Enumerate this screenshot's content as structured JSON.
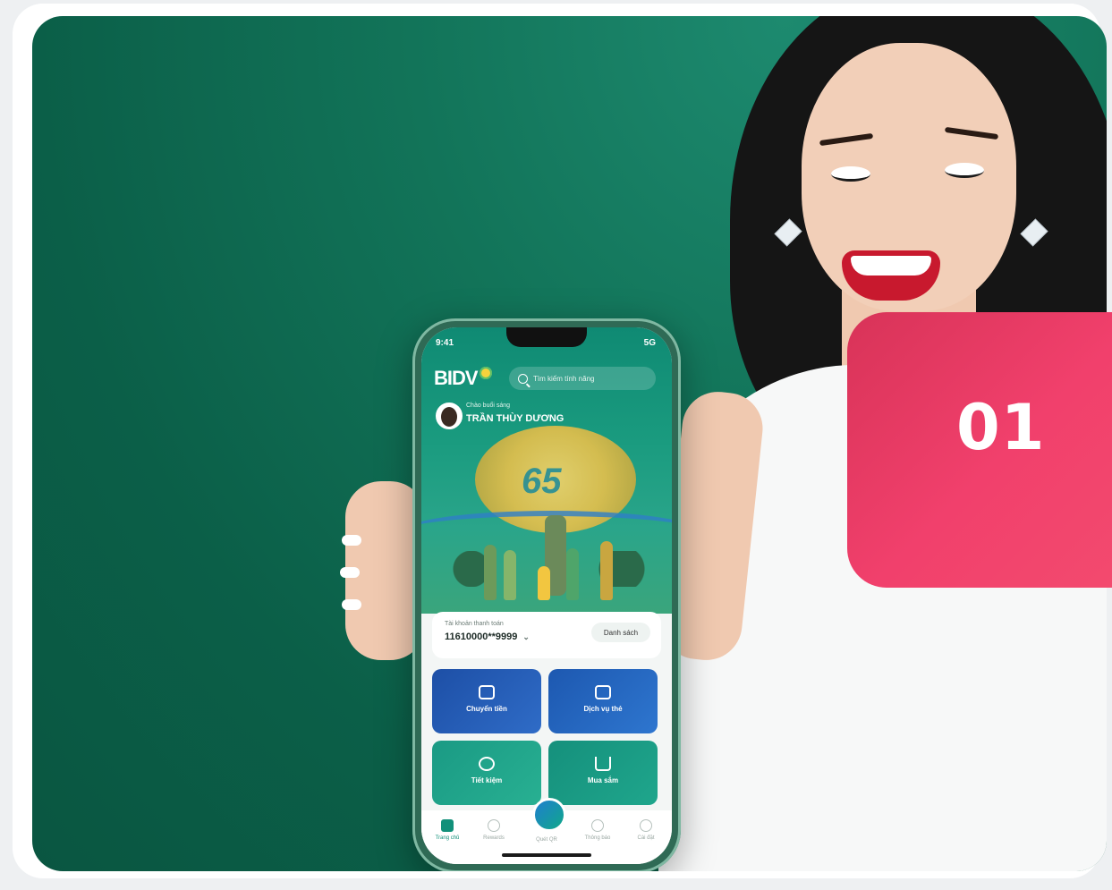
{
  "badge": {
    "number": "01"
  },
  "phone": {
    "status": {
      "time": "9:41",
      "signal": "5G"
    },
    "app": {
      "brand": "BIDV",
      "search_placeholder": "Tìm kiếm tính năng",
      "greeting": "Chào buổi sáng",
      "user_name": "TRẦN THÙY DƯƠNG",
      "banner_text": "65"
    },
    "account": {
      "label": "Tài khoản thanh toán",
      "number": "11610000**9999",
      "list_button": "Danh sách"
    },
    "tiles": [
      {
        "label": "Chuyển tiền",
        "icon": "transfer-icon"
      },
      {
        "label": "Dịch vụ thẻ",
        "icon": "card-icon"
      },
      {
        "label": "Tiết kiệm",
        "icon": "piggy-bank-icon"
      },
      {
        "label": "Mua sắm",
        "icon": "cart-icon"
      }
    ],
    "nav": [
      {
        "label": "Trang chủ",
        "icon": "home-icon",
        "active": true
      },
      {
        "label": "Rewards",
        "icon": "rewards-icon"
      },
      {
        "label": "Quét QR",
        "icon": "qr-icon"
      },
      {
        "label": "Thông báo",
        "icon": "bell-icon"
      },
      {
        "label": "Cài đặt",
        "icon": "gear-icon"
      }
    ]
  },
  "colors": {
    "brand_green": "#127459",
    "badge_pink": "#f1406c",
    "tile_blue": "#1d4fa6",
    "tile_teal": "#1a9a84"
  }
}
